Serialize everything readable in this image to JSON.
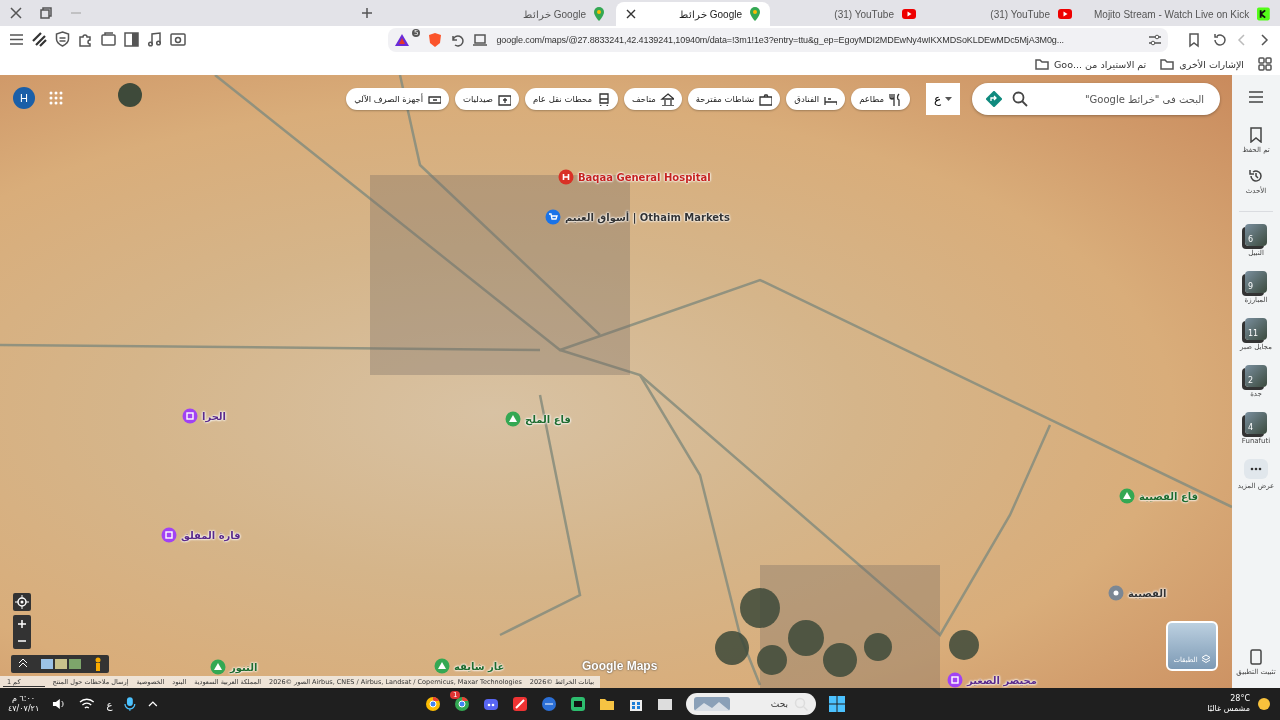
{
  "tabs": [
    {
      "title": "Mojito Stream - Watch Live on Kick",
      "kind": "kick",
      "selected": false
    },
    {
      "title": "(31) YouTube",
      "kind": "youtube",
      "selected": false
    },
    {
      "title": "(31) YouTube",
      "kind": "youtube",
      "selected": false
    },
    {
      "title": "خرائط Google",
      "kind": "maps",
      "selected": true
    },
    {
      "title": "خرائط Google",
      "kind": "maps",
      "selected": false
    }
  ],
  "toolbar": {
    "url": "google.com/maps/@27.8833241,42.4139241,10940m/data=!3m1!1e3?entry=ttu&g_ep=EgoyMDI2MDEwNy4wIKXMDSoKLDEwMDc5MjA3M0g...",
    "shield_count": "5"
  },
  "bookmarks": [
    "الإشارات الأخرى",
    "تم الاستيراد من ...Goo"
  ],
  "maps": {
    "search": {
      "placeholder": "البحث في \"خرائط Google\""
    },
    "language": "ع",
    "chips": [
      "مطاعم",
      "الفنادق",
      "نشاطات مقترحة",
      "متاحف",
      "محطات نقل عام",
      "صيدليات",
      "أجهزة الصرف الآلي"
    ],
    "account": "H",
    "sidebar": [
      {
        "label": "تم الحفظ",
        "kind": "saved"
      },
      {
        "label": "الأحدث",
        "kind": "recent"
      },
      {
        "label": "النبيل",
        "kind": "place",
        "badge": "6"
      },
      {
        "label": "المبارزة",
        "kind": "place",
        "badge": "9"
      },
      {
        "label": "مجايل صبر",
        "kind": "place",
        "badge": "11"
      },
      {
        "label": "جدة",
        "kind": "place",
        "badge": "2"
      },
      {
        "label": "Funafuti",
        "kind": "place",
        "badge": "4"
      },
      {
        "label": "عرض المزيد",
        "kind": "more"
      }
    ],
    "install": "تثبيت التطبيق",
    "places": [
      {
        "name": "Baqaa General Hospital",
        "kind": "hospital",
        "color": "#d93025"
      },
      {
        "name": "أسواق العثيم | Othaim Markets",
        "kind": "shop",
        "color": "#1a73e8"
      },
      {
        "name": "قاع الملح",
        "kind": "nature",
        "color": "#34a853"
      },
      {
        "name": "الحرا",
        "kind": "landmark",
        "color": "#a142f4"
      },
      {
        "name": "غار شايقه",
        "kind": "nature",
        "color": "#34a853"
      },
      {
        "name": "التنور",
        "kind": "nature",
        "color": "#34a853"
      },
      {
        "name": "قاع القصيبة",
        "kind": "nature",
        "color": "#34a853"
      },
      {
        "name": "مجيصر الصغير",
        "kind": "landmark",
        "color": "#a142f4"
      },
      {
        "name": "القصيبة",
        "kind": "town",
        "color": "#7b8794"
      },
      {
        "name": "قارة المفلق",
        "kind": "landmark",
        "color": "#a142f4"
      }
    ],
    "layers_label": "الطبقات",
    "logo": "Google Maps",
    "footer": [
      "بيانات الخرائط ©2026",
      "الصور ©2026 Airbus, CNES / Airbus, Landsat / Copernicus, Maxar Technologies",
      "المملكة العربية السعودية",
      "البنود",
      "الخصوصية",
      "إرسال ملاحظات حول المنتج"
    ],
    "scale": "1 كم"
  },
  "taskbar": {
    "weather_temp": "28°C",
    "weather_text": "مشمس غالبًا",
    "search": "بحث",
    "language": "ع",
    "time": "٦:٠٠ م",
    "date": "٤٧/٠٧/٢١",
    "mail_badge": "1"
  }
}
